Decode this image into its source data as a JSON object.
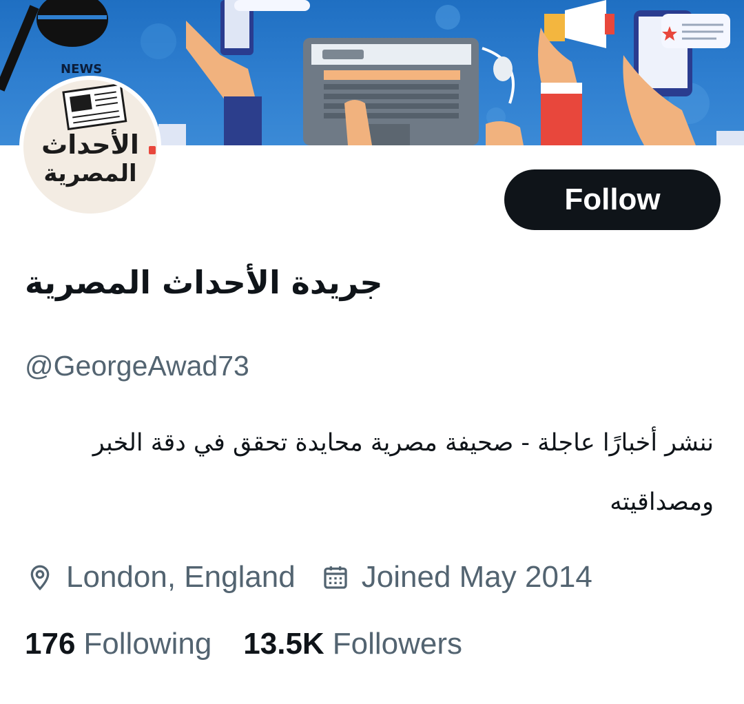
{
  "banner": {
    "news_label": "NEWS"
  },
  "avatar": {
    "line1": "الأحداث",
    "line2": "المصرية"
  },
  "follow_label": "Follow",
  "profile": {
    "display_name": "جريدة الأحداث المصرية",
    "handle": "@GeorgeAwad73",
    "bio": "ننشر أخبارًا عاجلة - صحيفة مصرية محايدة تحقق في دقة الخبر ومصداقيته",
    "location": "London, England",
    "joined": "Joined May 2014"
  },
  "stats": {
    "following_count": "176",
    "following_label": "Following",
    "followers_count": "13.5K",
    "followers_label": "Followers"
  },
  "colors": {
    "primary_text": "#0f1419",
    "secondary_text": "#536471",
    "button_bg": "#0f1419",
    "banner_blue": "#2f7fd0"
  },
  "icons": {
    "location": "location-pin-icon",
    "joined": "calendar-icon"
  }
}
